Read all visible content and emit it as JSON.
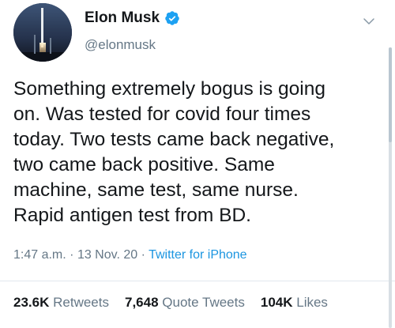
{
  "author": {
    "display_name": "Elon Musk",
    "handle": "@elonmusk",
    "verified": true,
    "verified_color": "#1da1f2"
  },
  "tweet": {
    "lines": [
      "Something extremely bogus is going",
      "on. Was tested for covid four times",
      "today. Two tests came back negative,",
      "two came back positive. Same",
      "machine, same test, same nurse.",
      "Rapid antigen test from BD."
    ]
  },
  "meta": {
    "time": "1:47 a.m.",
    "separator": "·",
    "date": "13 Nov. 20",
    "source": "Twitter for iPhone"
  },
  "stats": {
    "retweets_count": "23.6K",
    "retweets_label": "Retweets",
    "quote_tweets_count": "7,648",
    "quote_tweets_label": "Quote Tweets",
    "likes_count": "104K",
    "likes_label": "Likes"
  },
  "colors": {
    "link": "#1b95e0",
    "secondary_text": "#657786",
    "primary_text": "#14171a"
  },
  "icons": {
    "verified": "verified-badge-icon",
    "menu": "chevron-down-icon"
  }
}
